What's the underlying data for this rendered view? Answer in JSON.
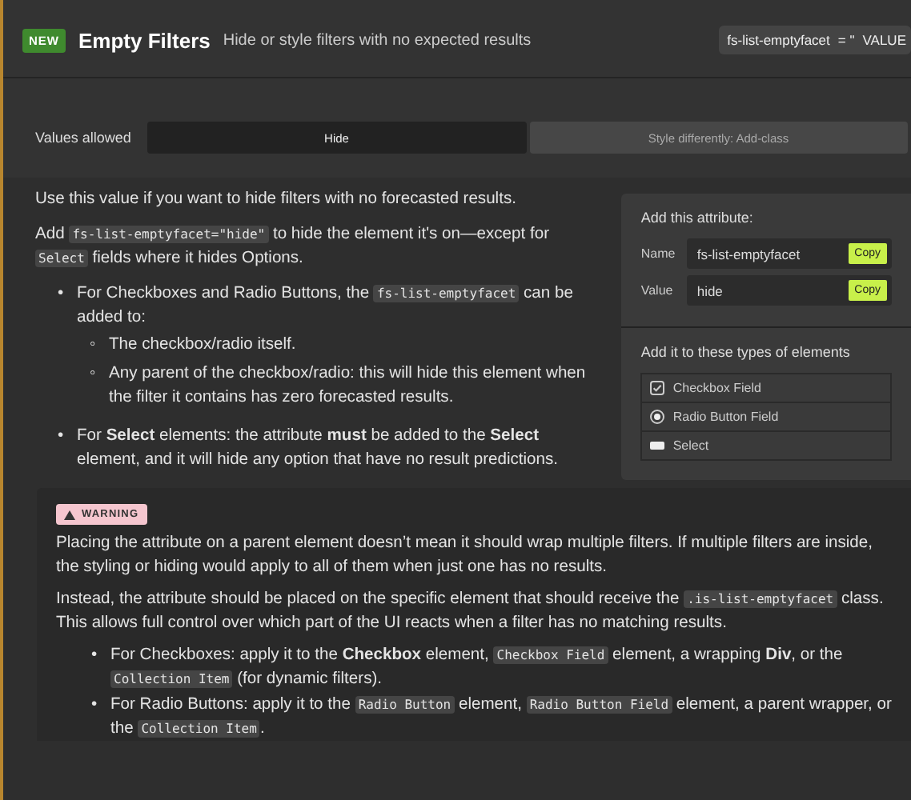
{
  "header": {
    "badge": "NEW",
    "title": "Empty Filters",
    "subtitle": "Hide or style filters with no expected results",
    "attribute_chip": {
      "name": "fs-list-emptyfacet",
      "equals": "= \"",
      "value": "VALUE"
    }
  },
  "values_allowed": {
    "label": "Values allowed",
    "options": [
      {
        "label": "Hide",
        "selected": true
      },
      {
        "label": "Style differently: Add-class",
        "selected": false
      }
    ]
  },
  "description": {
    "paragraphs": [
      [
        {
          "kind": "text",
          "text": "Use this value if you want to hide filters with no forecasted results."
        }
      ],
      [
        {
          "kind": "text",
          "text": "Add "
        },
        {
          "kind": "code",
          "text": "fs-list-emptyfacet=\"hide\""
        },
        {
          "kind": "text",
          "text": " to hide the element it's on—except for "
        },
        {
          "kind": "code",
          "text": "Select"
        },
        {
          "kind": "text",
          "text": " fields where it hides Options."
        }
      ]
    ],
    "bullets": [
      {
        "marker": "•",
        "segments": [
          {
            "kind": "text",
            "text": "For Checkboxes and Radio Buttons, the "
          },
          {
            "kind": "code",
            "text": "fs-list-emptyfacet"
          },
          {
            "kind": "text",
            "text": " can be added to:"
          }
        ],
        "children": [
          {
            "marker": "◦",
            "segments": [
              {
                "kind": "text",
                "text": "The checkbox/radio itself."
              }
            ]
          },
          {
            "marker": "◦",
            "segments": [
              {
                "kind": "text",
                "text": "Any parent of the checkbox/radio: this will hide this element when the filter it contains has zero forecasted results."
              }
            ]
          }
        ]
      },
      {
        "marker": "•",
        "segments": [
          {
            "kind": "text",
            "text": "For **Select** elements: the attribute **must** be added to the **Select** element, and it will hide any option that have no result predictions."
          }
        ]
      }
    ]
  },
  "attribute_panel": {
    "title": "Add this attribute:",
    "fields": [
      {
        "label": "Name",
        "value": "fs-list-emptyfacet",
        "button": "Copy"
      },
      {
        "label": "Value",
        "value": "hide",
        "button": "Copy"
      }
    ],
    "types_title": "Add it to these types of elements",
    "types": [
      {
        "kind": "checkbox",
        "label": "Checkbox Field"
      },
      {
        "kind": "radio",
        "label": "Radio Button Field"
      },
      {
        "kind": "select",
        "label": "Select"
      }
    ]
  },
  "warning": {
    "badge": "WARNING",
    "paragraphs": [
      [
        {
          "kind": "text",
          "text": "Placing the attribute on a parent element doesn’t mean it should wrap multiple filters. If multiple filters are inside, the styling or hiding would apply to all of them when just one has no results."
        }
      ],
      [
        {
          "kind": "text",
          "text": "Instead, the attribute should be placed on the specific element that should receive the "
        },
        {
          "kind": "code",
          "text": ".is-list-emptyfacet"
        },
        {
          "kind": "text",
          "text": " class. This allows full control over which part of the UI reacts when a filter has no matching results."
        }
      ]
    ],
    "bullets": [
      {
        "marker": "•",
        "segments": [
          {
            "kind": "text",
            "text": "For Checkboxes: apply it to the **Checkbox** element, "
          },
          {
            "kind": "code",
            "text": "Checkbox Field"
          },
          {
            "kind": "text",
            "text": " element, a wrapping **Div**, or the "
          },
          {
            "kind": "code",
            "text": "Collection Item"
          },
          {
            "kind": "text",
            "text": " (for dynamic filters)."
          }
        ]
      },
      {
        "marker": "•",
        "segments": [
          {
            "kind": "text",
            "text": "For Radio Buttons: apply it to the "
          },
          {
            "kind": "code",
            "text": "Radio Button"
          },
          {
            "kind": "text",
            "text": " element, "
          },
          {
            "kind": "code",
            "text": "Radio Button Field"
          },
          {
            "kind": "text",
            "text": " element, a parent wrapper, or the "
          },
          {
            "kind": "code",
            "text": "Collection Item"
          },
          {
            "kind": "text",
            "text": "."
          }
        ]
      }
    ]
  }
}
